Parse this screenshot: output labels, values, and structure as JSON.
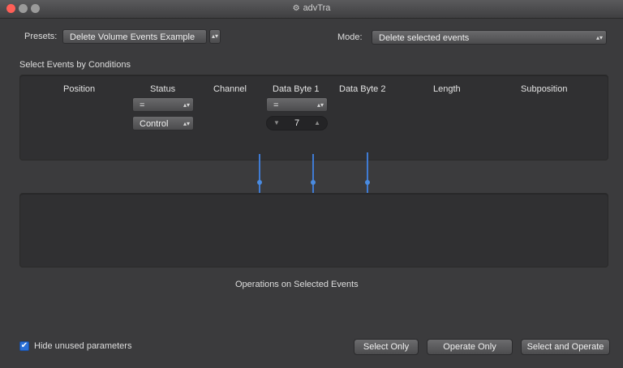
{
  "window": {
    "title": "advTra"
  },
  "presets": {
    "label": "Presets:",
    "value": "Delete Volume Events Example"
  },
  "mode": {
    "label": "Mode:",
    "value": "Delete selected events"
  },
  "section": {
    "select_title": "Select Events by Conditions",
    "operations_title": "Operations on Selected Events"
  },
  "columns": [
    "Position",
    "Status",
    "Channel",
    "Data Byte 1",
    "Data Byte 2",
    "Length",
    "Subposition"
  ],
  "status": {
    "condition": "=",
    "value": "Control"
  },
  "data_byte_1": {
    "condition": "=",
    "value": "7"
  },
  "footer": {
    "hide_unused_label": "Hide unused parameters",
    "hide_unused_checked": true,
    "buttons": {
      "select_only": "Select Only",
      "operate_only": "Operate Only",
      "select_and_operate": "Select and Operate"
    }
  },
  "colors": {
    "accent": "#2a6fd6",
    "connector": "#3f7bd3",
    "close": "#ff5f57"
  }
}
